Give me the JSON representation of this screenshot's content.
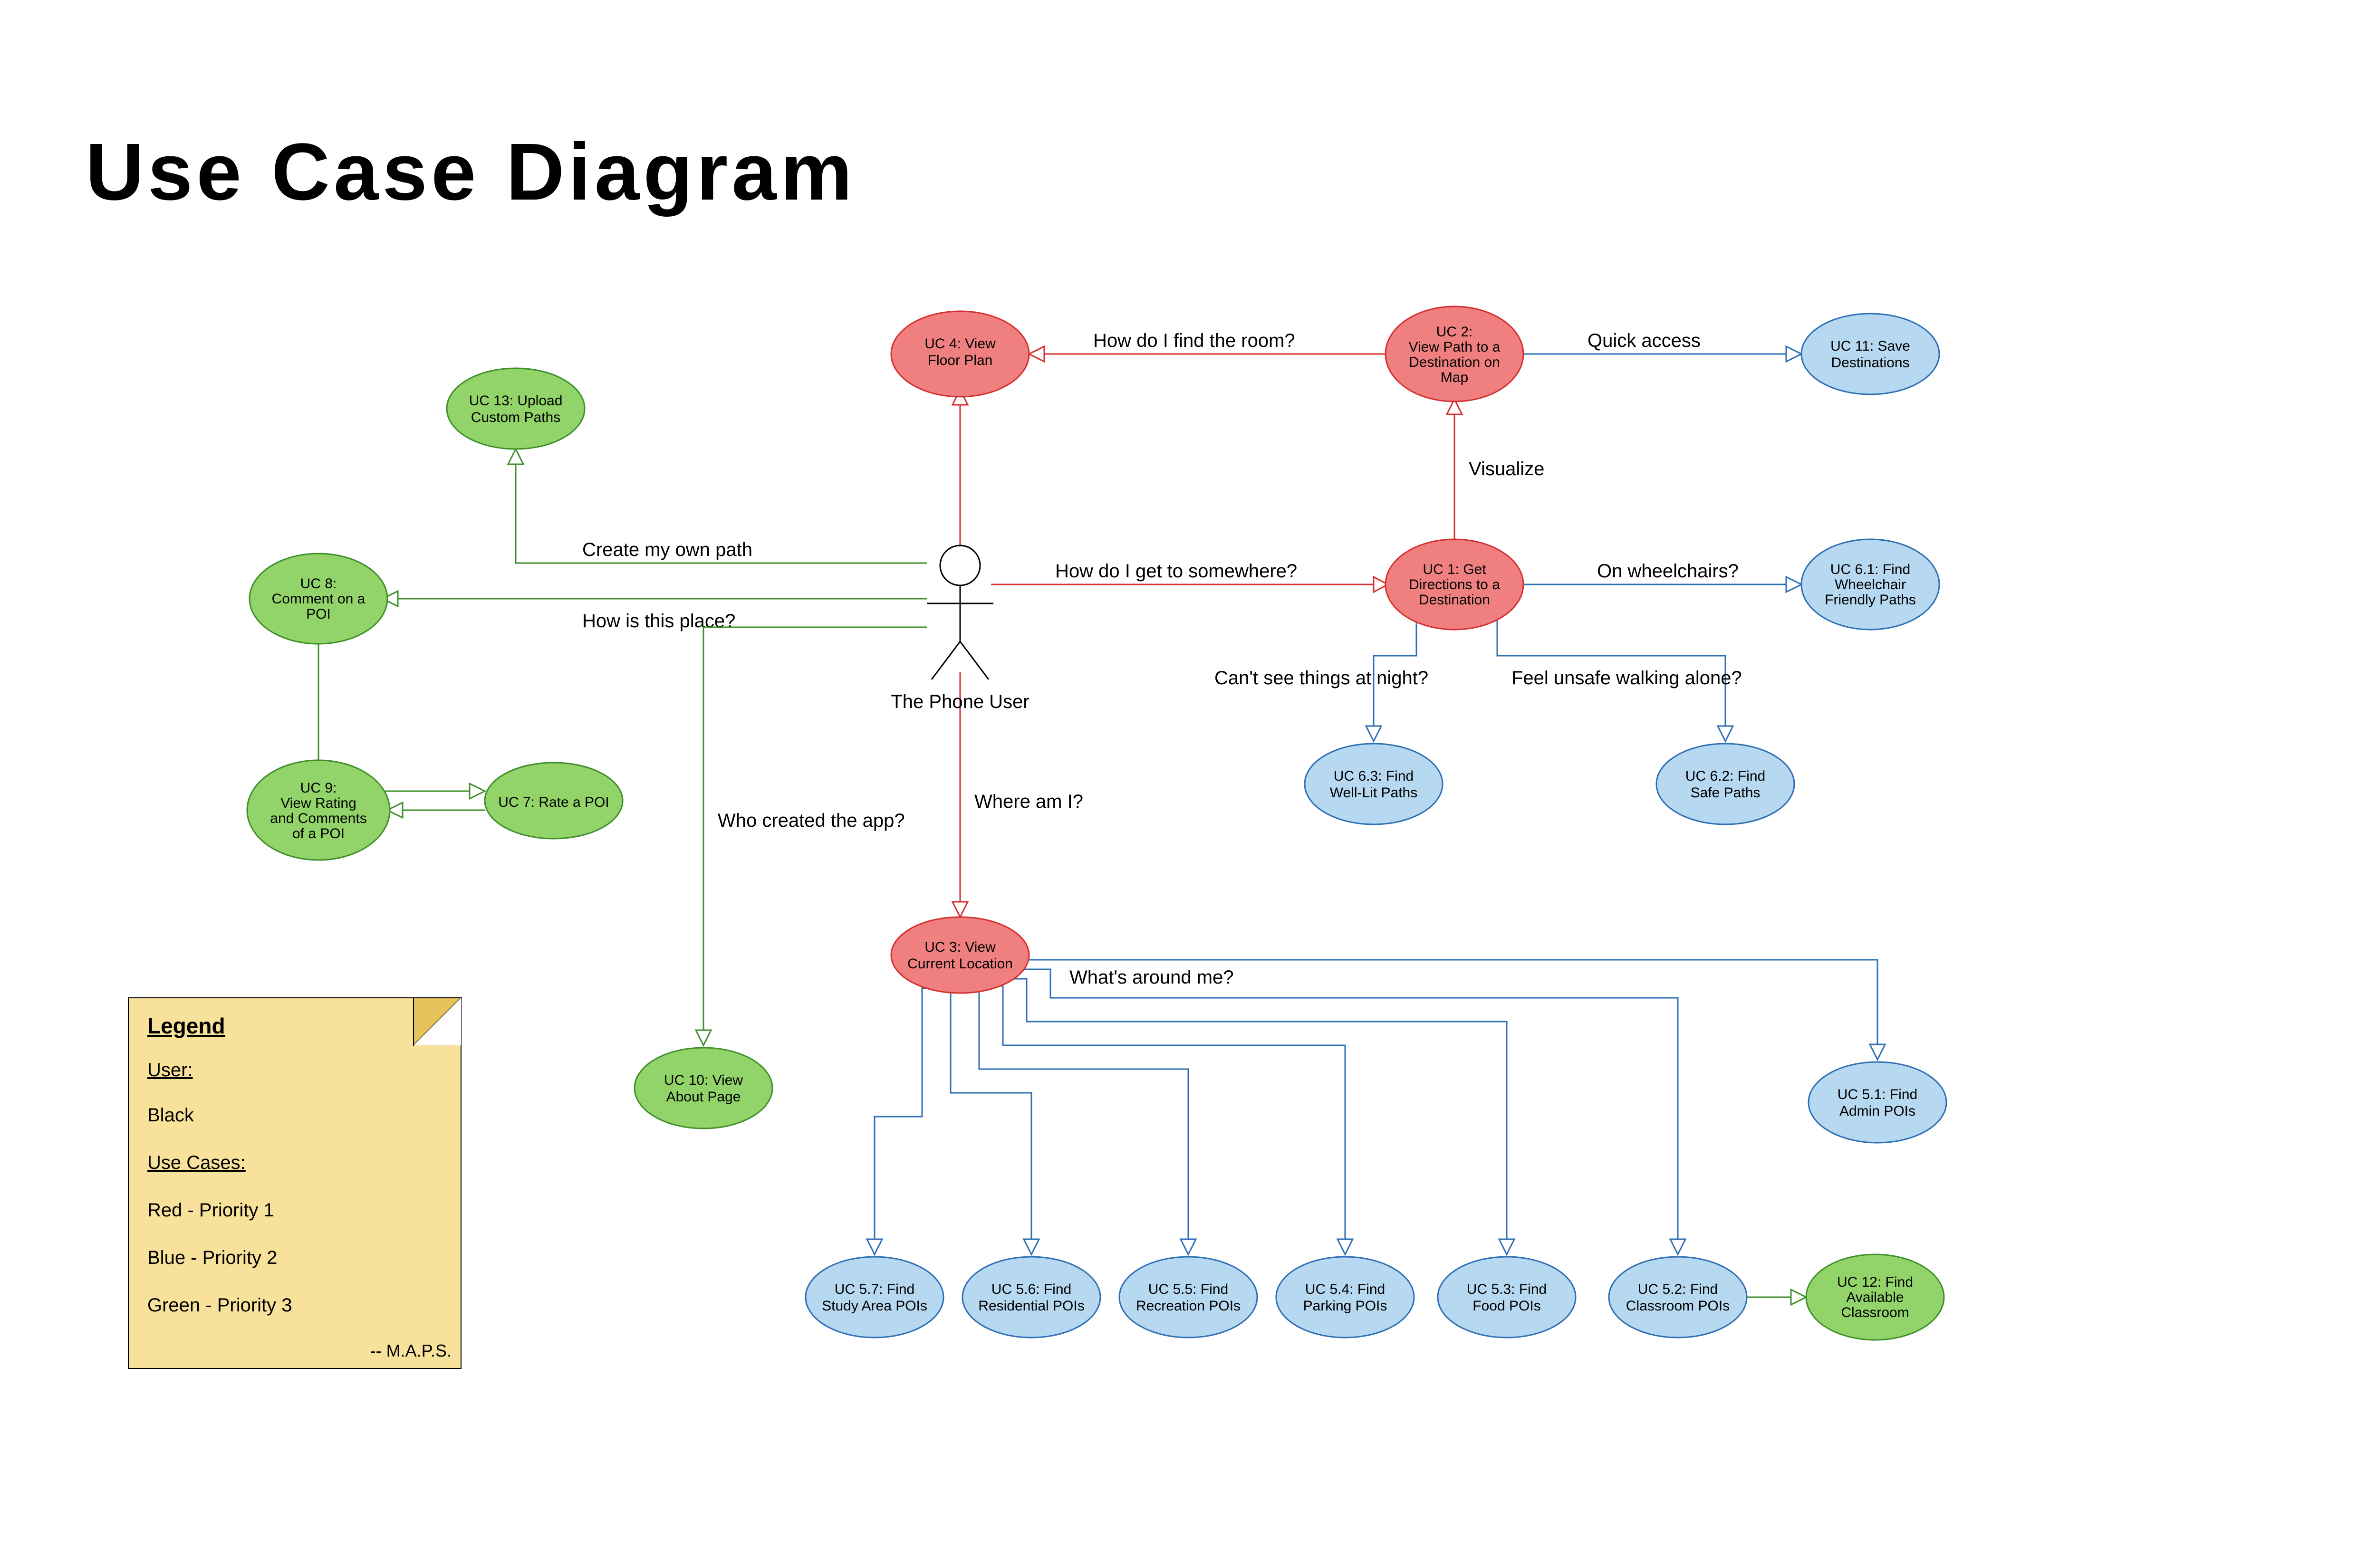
{
  "title": "Use Case Diagram",
  "actor": {
    "label": "The Phone User"
  },
  "nodes": {
    "uc1": {
      "label": "UC 1: Get Directions to a Destination"
    },
    "uc2": {
      "label": "UC 2: View Path to a Destination on Map"
    },
    "uc3": {
      "label": "UC 3: View Current Location"
    },
    "uc4": {
      "label": "UC 4: View Floor Plan"
    },
    "uc51": {
      "label": "UC 5.1: Find Admin POIs"
    },
    "uc52": {
      "label": "UC 5.2: Find Classroom POIs"
    },
    "uc53": {
      "label": "UC 5.3: Find Food POIs"
    },
    "uc54": {
      "label": "UC 5.4: Find Parking POIs"
    },
    "uc55": {
      "label": "UC 5.5: Find Recreation POIs"
    },
    "uc56": {
      "label": "UC 5.6: Find Residential POIs"
    },
    "uc57": {
      "label": "UC 5.7: Find Study Area POIs"
    },
    "uc61": {
      "label": "UC 6.1: Find Wheelchair Friendly Paths"
    },
    "uc62": {
      "label": "UC 6.2: Find Safe Paths"
    },
    "uc63": {
      "label": "UC 6.3: Find Well-Lit Paths"
    },
    "uc7": {
      "label": "UC 7: Rate a POI"
    },
    "uc8": {
      "label": "UC 8: Comment on a POI"
    },
    "uc9": {
      "label": "UC 9: View Rating and Comments of a POI"
    },
    "uc10": {
      "label": "UC 10: View About Page"
    },
    "uc11": {
      "label": "UC 11: Save Destinations"
    },
    "uc12": {
      "label": "UC 12: Find Available Classroom"
    },
    "uc13": {
      "label": "UC 13: Upload Custom Paths"
    }
  },
  "edges": {
    "a_uc1": {
      "label": "How do I get to somewhere?"
    },
    "a_uc4": {
      "label": ""
    },
    "a_uc3": {
      "label": "Where am I?"
    },
    "a_uc13": {
      "label": "Create my own path"
    },
    "a_uc8": {
      "label": "How is this place?"
    },
    "a_uc10": {
      "label": "Who created the app?"
    },
    "uc1_uc2": {
      "label": "Visualize"
    },
    "uc2_uc4": {
      "label": "How do I find the room?"
    },
    "uc2_uc11": {
      "label": "Quick access"
    },
    "uc1_uc61": {
      "label": "On wheelchairs?"
    },
    "uc1_uc62": {
      "label": "Feel unsafe walking alone?"
    },
    "uc1_uc63": {
      "label": "Can't see things at night?"
    },
    "uc3_fan": {
      "label": "What's around me?"
    },
    "uc52_uc12": {
      "label": ""
    },
    "uc8_uc9": {
      "label": ""
    },
    "uc7_uc9": {
      "label": ""
    },
    "uc8_uc7": {
      "label": ""
    }
  },
  "legend": {
    "title": "Legend",
    "user_h": "User:",
    "user_l": "Black",
    "uc_h": "Use Cases:",
    "p1": "Red - Priority 1",
    "p2": "Blue - Priority 2",
    "p3": "Green - Priority 3",
    "sign": "-- M.A.P.S."
  },
  "colors": {
    "red": "#f08080",
    "blue": "#b6d8f0",
    "green": "#92d469",
    "red_stroke": "#d62f2f",
    "blue_stroke": "#2e6fb5",
    "green_stroke": "#3f8f2b"
  }
}
